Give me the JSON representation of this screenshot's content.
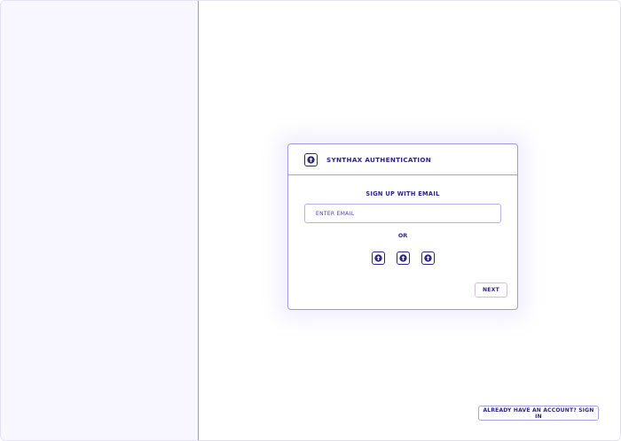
{
  "card": {
    "logo_icon": "arrow-up-circle-icon",
    "title": "SYNTHAX AUTHENTICATION",
    "subtitle": "SIGN UP WITH EMAIL",
    "email_placeholder": "ENTER EMAIL",
    "email_value": "",
    "divider_text": "OR",
    "providers": [
      {
        "icon": "arrow-up-circle-icon"
      },
      {
        "icon": "arrow-up-circle-icon"
      },
      {
        "icon": "arrow-up-circle-icon"
      }
    ],
    "next_label": "NEXT"
  },
  "footer": {
    "signin_label": "ALREADY HAVE AN ACCOUNT? SIGN IN"
  },
  "colors": {
    "accent": "#2a2380",
    "sidebar_bg": "#f8f6fe",
    "divider": "#9a92e6"
  }
}
